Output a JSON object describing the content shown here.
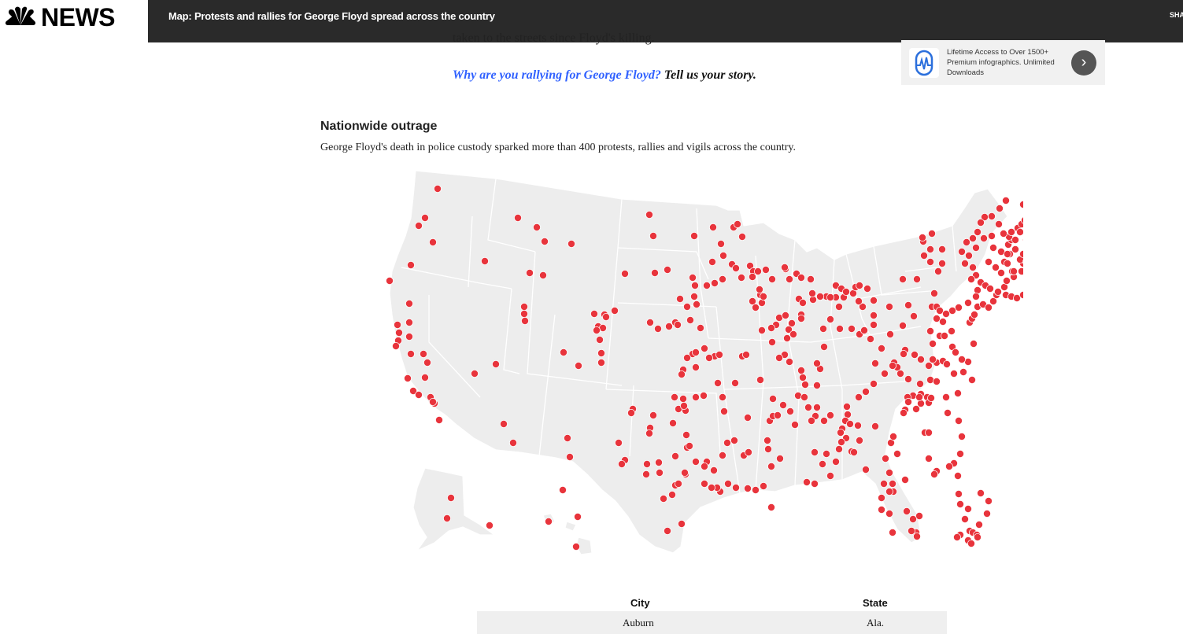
{
  "header": {
    "logo_text": "NEWS",
    "headline": "Map: Protests and rallies for George Floyd spread across the country",
    "share_label": "SHA"
  },
  "article": {
    "cutoff_text": "taken to the streets since Floyd's killing.",
    "cta_link": "Why are you rallying for George Floyd?",
    "cta_tail": " Tell us your story."
  },
  "ad": {
    "text": "Lifetime Access to Over 1500+ Premium infographics. Unlimited Downloads",
    "arrow": "›"
  },
  "section": {
    "title": "Nationwide outrage",
    "description": "George Floyd's death in police custody sparked more than 400 protests, rallies and vigils across the country."
  },
  "colors": {
    "dot": "#e8343c",
    "land": "#ededed",
    "border": "#ffffff",
    "topbar": "#2a2a2a"
  },
  "table": {
    "headers": [
      "City",
      "State"
    ],
    "rows": [
      [
        "Auburn",
        "Ala."
      ]
    ]
  }
}
